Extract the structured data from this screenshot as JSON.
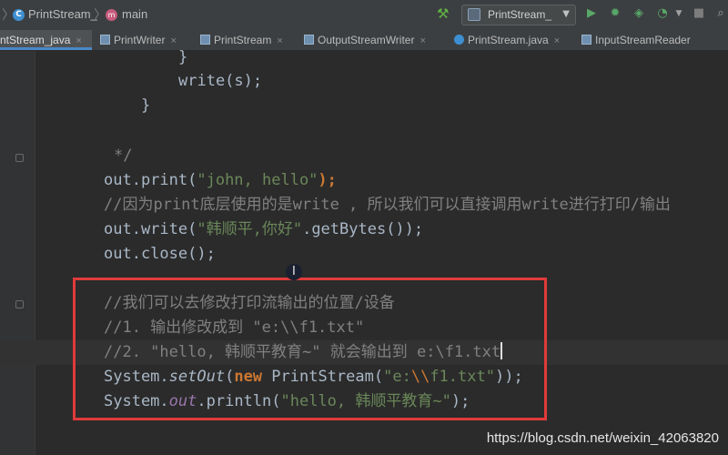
{
  "colors": {
    "background": "#2b2b2b",
    "keyword": "#cc7832",
    "string": "#6a8759",
    "comment": "#808080",
    "static": "#9876aa",
    "highlight": "#e03a3a"
  },
  "nav": {
    "breadcrumb_file": "PrintStream_",
    "breadcrumb_method": "main"
  },
  "toolbar": {
    "run_config": "PrintStream_"
  },
  "tabs": [
    {
      "label": "ntStream_java"
    },
    {
      "label": "PrintWriter"
    },
    {
      "label": "PrintStream"
    },
    {
      "label": "OutputStreamWriter"
    },
    {
      "label": "PrintStream.java"
    },
    {
      "label": "InputStreamReader"
    }
  ],
  "code": {
    "l1": "}",
    "l2": "write(s);",
    "l3": "}",
    "l4": "*/",
    "l5a": "out.print(",
    "l5b": "\"john, hello\"",
    "l5c": ");",
    "l6": "//因为print底层使用的是write , 所以我们可以直接调用write进行打印/输出",
    "l7a": "out.write(",
    "l7b": "\"韩顺平,你好\"",
    "l7c": ".getBytes());",
    "l8": "out.close();",
    "l9": "//我们可以去修改打印流输出的位置/设备",
    "l10": "//1. 输出修改成到 \"e:\\\\f1.txt\"",
    "l11": "//2. \"hello, 韩顺平教育~\" 就会输出到 e:\\f1.txt",
    "l12a": "System.",
    "l12b": "setOut",
    "l12c": "(",
    "l12d": "new",
    "l12e": " PrintStream(",
    "l12f": "\"e:",
    "l12g": "\\\\",
    "l12h": "f1.txt\"",
    "l12i": "));",
    "l13a": "System.",
    "l13b": "out",
    "l13c": ".println(",
    "l13d": "\"hello, 韩顺平教育~\"",
    "l13e": ");"
  },
  "watermark": "https://blog.csdn.net/weixin_42063820"
}
